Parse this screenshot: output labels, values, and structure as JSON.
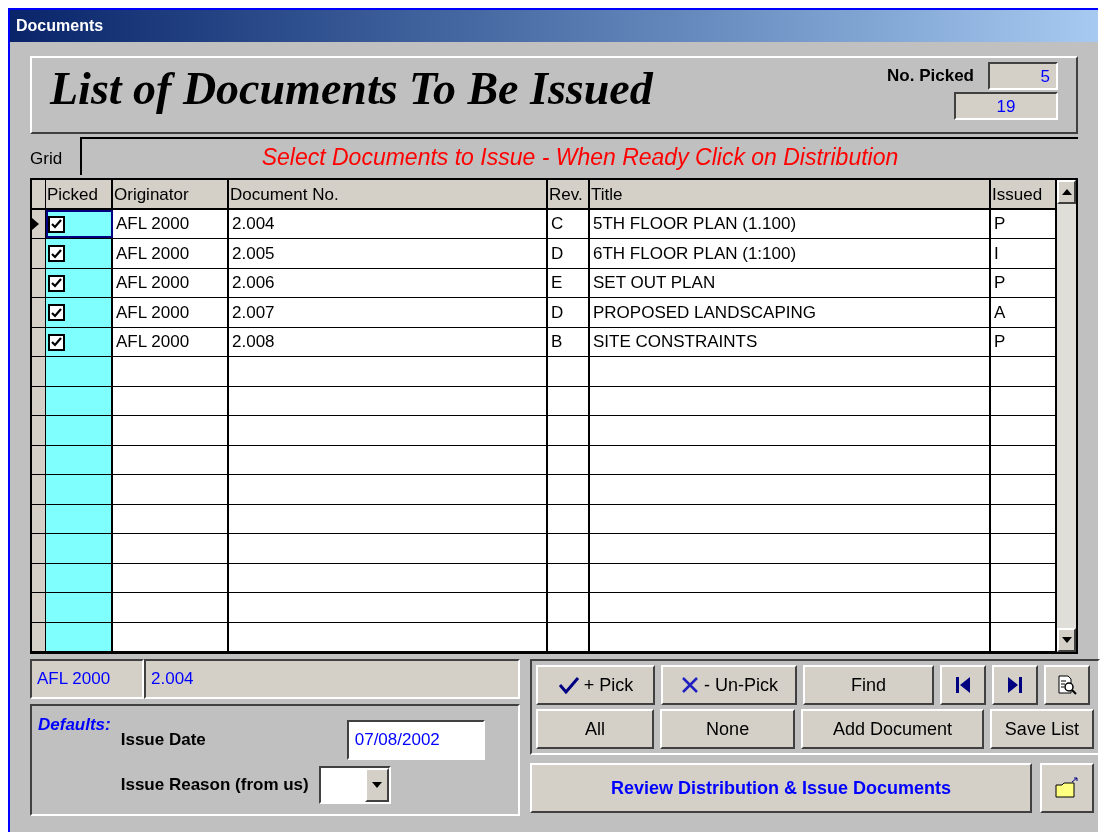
{
  "window": {
    "title": "Documents"
  },
  "header": {
    "title": "List of Documents To Be Issued",
    "picked_label": "No. Picked",
    "picked_count": "5",
    "total_count": "19"
  },
  "grid": {
    "label": "Grid",
    "instruction": "Select Documents to Issue - When Ready Click on Distribution",
    "columns": [
      "Picked",
      "Originator",
      "Document No.",
      "Rev.",
      "Title",
      "Issued"
    ],
    "rows": [
      {
        "picked": true,
        "selected": true,
        "originator": "AFL 2000",
        "document_no": "2.004",
        "rev": "C",
        "title": "5TH FLOOR PLAN (1.100)",
        "issued": "P"
      },
      {
        "picked": true,
        "selected": false,
        "originator": "AFL 2000",
        "document_no": "2.005",
        "rev": "D",
        "title": "6TH FLOOR PLAN (1:100)",
        "issued": "I"
      },
      {
        "picked": true,
        "selected": false,
        "originator": "AFL 2000",
        "document_no": "2.006",
        "rev": "E",
        "title": "SET OUT PLAN",
        "issued": "P"
      },
      {
        "picked": true,
        "selected": false,
        "originator": "AFL 2000",
        "document_no": "2.007",
        "rev": "D",
        "title": "PROPOSED LANDSCAPING",
        "issued": "A"
      },
      {
        "picked": true,
        "selected": false,
        "originator": "AFL 2000",
        "document_no": "2.008",
        "rev": "B",
        "title": "SITE CONSTRAINTS",
        "issued": "P"
      }
    ]
  },
  "current": {
    "originator": "AFL 2000",
    "document_no": "2.004"
  },
  "defaults": {
    "label": "Defaults:",
    "issue_date_label": "Issue Date",
    "issue_date": "07/08/2002",
    "issue_reason_label": "Issue Reason (from us)"
  },
  "buttons": [
    {
      "kind": "pick",
      "label": "+ Pick"
    },
    {
      "kind": "unpick",
      "label": "- Un-Pick"
    },
    {
      "kind": "text",
      "label": "Find"
    },
    {
      "kind": "first"
    },
    {
      "kind": "last"
    },
    {
      "kind": "preview"
    },
    {
      "kind": "text",
      "label": "All"
    },
    {
      "kind": "text",
      "label": "None"
    },
    {
      "kind": "wide",
      "label": "Add Document"
    },
    {
      "kind": "text",
      "label": "Save List"
    }
  ],
  "review_button": "Review Distribution & Issue Documents"
}
